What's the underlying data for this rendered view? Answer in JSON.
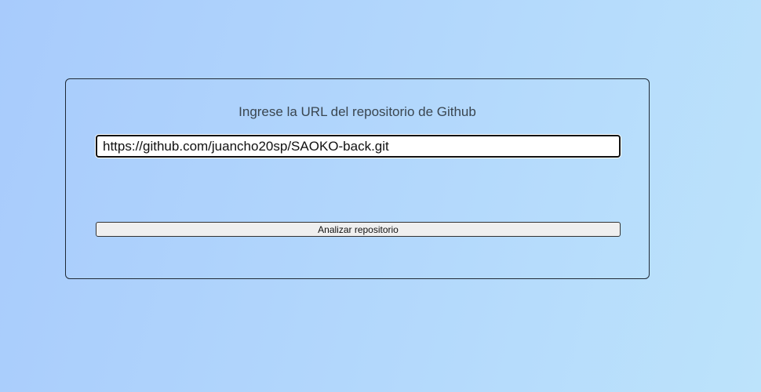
{
  "form": {
    "title": "Ingrese la URL del repositorio de Github",
    "url_value": "https://github.com/juancho20sp/SAOKO-back.git",
    "submit_label": "Analizar repositorio"
  },
  "colors": {
    "background_start": "#a8cbfc",
    "background_end": "#bce3fb",
    "card_border": "#1f2a36",
    "button_bg": "#efefef"
  }
}
